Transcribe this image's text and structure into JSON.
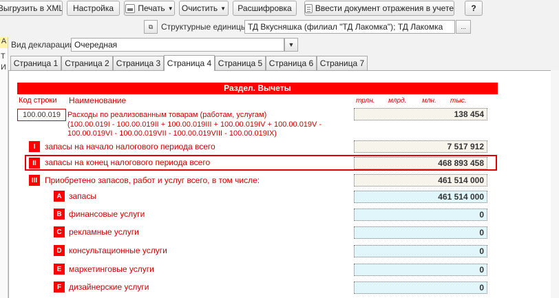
{
  "toolbar": {
    "export_xml": "Выгрузить в XML",
    "settings": "Настройка",
    "print": "Печать",
    "clear": "Очистить",
    "decode": "Расшифровка",
    "enter_doc": "Ввести документ отражения в учете",
    "help": "?"
  },
  "structural": {
    "label": "Структурные единицы:",
    "value": "ТД Вкусняшка (филиал \"ТД Лакомка\"); ТД Лакомка",
    "more": "..."
  },
  "declaration": {
    "label": "Вид декларации:",
    "value": "Очередная"
  },
  "left_strip": {
    "a": "А",
    "t": "Т",
    "i": "И"
  },
  "tabs": [
    "Страница 1",
    "Страница 2",
    "Страница 3",
    "Страница 4",
    "Страница 5",
    "Страница 6",
    "Страница 7"
  ],
  "section": {
    "title": "Раздел. Вычеты",
    "col_code": "Код строки",
    "col_name": "Наименование",
    "units": [
      "трлн.",
      "млрд.",
      "млн.",
      "тыс."
    ]
  },
  "main_row": {
    "code": "100.00.019",
    "text1": "Расходы по реализованным товарам (работам, услугам)",
    "text2": "(100.00.019I - 100.00.019II + 100.00.019III + 100.00.019IV + 100.00.019V -",
    "text3": "100.00.019VI - 100.00.019VII - 100.00.019VIII - 100.00.019IX)",
    "value": "138 454"
  },
  "rows": [
    {
      "badge": "I",
      "label": "запасы на начало налогового периода всего",
      "value": "7 517 912"
    },
    {
      "badge": "II",
      "label": "запасы на конец налогового периода всего",
      "value": "468 893 458"
    },
    {
      "badge": "III",
      "label": "Приобретено запасов, работ и услуг всего,  в том числе:",
      "value": "461 514 000"
    },
    {
      "badge": "A",
      "label": "запасы",
      "value": "461 514 000"
    },
    {
      "badge": "B",
      "label": "финансовые услуги",
      "value": "0"
    },
    {
      "badge": "C",
      "label": "рекламные услуги",
      "value": "0"
    },
    {
      "badge": "D",
      "label": "консультационные услуги",
      "value": "0"
    },
    {
      "badge": "E",
      "label": "маркетинговые услуги",
      "value": "0"
    },
    {
      "badge": "F",
      "label": "дизайнерские услуги",
      "value": "0"
    }
  ],
  "colors": {
    "accent_red": "#ff0000",
    "highlight": "#e00000",
    "cyan_field": "#e0f6fb",
    "beige_field": "#f7f4ec"
  }
}
